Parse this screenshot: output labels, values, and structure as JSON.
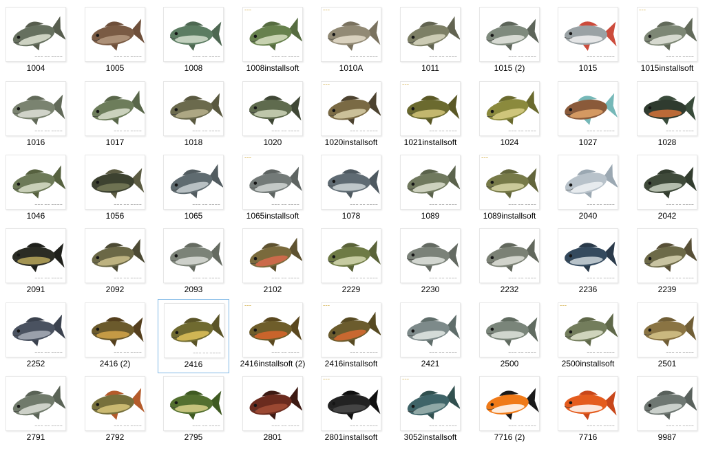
{
  "colors": {
    "selection_border": "#7fb8e6",
    "label_text": "#000000",
    "watermark_text": "#7a7a7a",
    "thumb_border": "#e7e7e7"
  },
  "files": [
    {
      "name": "1004",
      "icon": "fish-thumbnail-icon",
      "colors": {
        "body": "#66705f",
        "belly": "#dfe3d4",
        "fin": "#575d4e"
      }
    },
    {
      "name": "1005",
      "icon": "fish-thumbnail-icon",
      "colors": {
        "body": "#7a5b44",
        "belly": "#b59a80",
        "fin": "#6e4f3a"
      }
    },
    {
      "name": "1008",
      "icon": "fish-thumbnail-icon",
      "colors": {
        "body": "#5c7c62",
        "belly": "#d4dfcf",
        "fin": "#4e6852"
      }
    },
    {
      "name": "1008installsoft",
      "icon": "fish-thumbnail-icon",
      "colors": {
        "body": "#67814d",
        "belly": "#d8e1c2",
        "fin": "#566c40"
      }
    },
    {
      "name": "1010A",
      "icon": "fish-thumbnail-icon",
      "colors": {
        "body": "#928a75",
        "belly": "#e5ddcb",
        "fin": "#7a725f"
      }
    },
    {
      "name": "1011",
      "icon": "fish-thumbnail-icon",
      "colors": {
        "body": "#7d7f65",
        "belly": "#d9d8c2",
        "fin": "#626451"
      }
    },
    {
      "name": "1015 (2)",
      "icon": "fish-thumbnail-icon",
      "colors": {
        "body": "#7f8a7d",
        "belly": "#e6e8e2",
        "fin": "#5d655a"
      }
    },
    {
      "name": "1015",
      "icon": "fish-thumbnail-icon",
      "colors": {
        "body": "#9aa2a5",
        "belly": "#f1f1f1",
        "fin": "#cc4b3b"
      }
    },
    {
      "name": "1015installsoft",
      "icon": "fish-thumbnail-icon",
      "colors": {
        "body": "#7d8775",
        "belly": "#e5e7df",
        "fin": "#626a5a"
      }
    },
    {
      "name": "1016",
      "icon": "fish-thumbnail-icon",
      "colors": {
        "body": "#7a8370",
        "belly": "#dfe2d8",
        "fin": "#626a59"
      }
    },
    {
      "name": "1017",
      "icon": "fish-thumbnail-icon",
      "colors": {
        "body": "#6d7d5b",
        "belly": "#dce1cf",
        "fin": "#59674a"
      }
    },
    {
      "name": "1018",
      "icon": "fish-thumbnail-icon",
      "colors": {
        "body": "#6b6a4d",
        "belly": "#b9b18e",
        "fin": "#5a5940"
      }
    },
    {
      "name": "1020",
      "icon": "fish-thumbnail-icon",
      "colors": {
        "body": "#5f6b4e",
        "belly": "#cfd6bb",
        "fin": "#3f4735"
      }
    },
    {
      "name": "1020installsoft",
      "icon": "fish-thumbnail-icon",
      "colors": {
        "body": "#7a6a44",
        "belly": "#d9cfa8",
        "fin": "#4d4330"
      }
    },
    {
      "name": "1021installsoft",
      "icon": "fish-thumbnail-icon",
      "colors": {
        "body": "#6b6a2f",
        "belly": "#d2c479",
        "fin": "#5a5826"
      }
    },
    {
      "name": "1024",
      "icon": "fish-thumbnail-icon",
      "colors": {
        "body": "#8b8a3d",
        "belly": "#d9cf86",
        "fin": "#6a6a2e"
      }
    },
    {
      "name": "1027",
      "icon": "fish-thumbnail-icon",
      "colors": {
        "body": "#8a5a3a",
        "belly": "#e0a46a",
        "fin": "#75b8b8"
      }
    },
    {
      "name": "1028",
      "icon": "fish-thumbnail-icon",
      "colors": {
        "body": "#2f3b2f",
        "belly": "#d4733a",
        "fin": "#394b3a"
      }
    },
    {
      "name": "1046",
      "icon": "fish-thumbnail-icon",
      "colors": {
        "body": "#6d7a58",
        "belly": "#d9dfc9",
        "fin": "#56613f"
      }
    },
    {
      "name": "1056",
      "icon": "fish-thumbnail-icon",
      "colors": {
        "body": "#3d4230",
        "belly": "#777a58",
        "fin": "#5b5b42"
      }
    },
    {
      "name": "1065",
      "icon": "fish-thumbnail-icon",
      "colors": {
        "body": "#5f6b70",
        "belly": "#c8cfd1",
        "fin": "#525c60"
      }
    },
    {
      "name": "1065installsoft",
      "icon": "fish-thumbnail-icon",
      "colors": {
        "body": "#737a78",
        "belly": "#d1d6d3",
        "fin": "#5e6462"
      }
    },
    {
      "name": "1078",
      "icon": "fish-thumbnail-icon",
      "colors": {
        "body": "#5f6b73",
        "belly": "#cfd6d8",
        "fin": "#4e5960"
      }
    },
    {
      "name": "1089",
      "icon": "fish-thumbnail-icon",
      "colors": {
        "body": "#70795e",
        "belly": "#dde1cf",
        "fin": "#5b634c"
      }
    },
    {
      "name": "1089installsoft",
      "icon": "fish-thumbnail-icon",
      "colors": {
        "body": "#777a48",
        "belly": "#d8d7a8",
        "fin": "#62653b"
      }
    },
    {
      "name": "2040",
      "icon": "fish-thumbnail-icon",
      "colors": {
        "body": "#b8c2ca",
        "belly": "#eef2f5",
        "fin": "#9ba8b2"
      }
    },
    {
      "name": "2042",
      "icon": "fish-thumbnail-icon",
      "colors": {
        "body": "#3f4a3a",
        "belly": "#c9d1c2",
        "fin": "#323c2e"
      }
    },
    {
      "name": "2091",
      "icon": "fish-thumbnail-icon",
      "colors": {
        "body": "#2b2c24",
        "belly": "#b9a75a",
        "fin": "#1f201b"
      }
    },
    {
      "name": "2092",
      "icon": "fish-thumbnail-icon",
      "colors": {
        "body": "#6b6846",
        "belly": "#cbbf8b",
        "fin": "#4c4a34"
      }
    },
    {
      "name": "2093",
      "icon": "fish-thumbnail-icon",
      "colors": {
        "body": "#7c8378",
        "belly": "#dcded8",
        "fin": "#656b61"
      }
    },
    {
      "name": "2102",
      "icon": "fish-thumbnail-icon",
      "colors": {
        "body": "#7a6a3c",
        "belly": "#d96a4c",
        "fin": "#5e5230"
      }
    },
    {
      "name": "2229",
      "icon": "fish-thumbnail-icon",
      "colors": {
        "body": "#6e7a45",
        "belly": "#d6d9b1",
        "fin": "#5a6339"
      }
    },
    {
      "name": "2230",
      "icon": "fish-thumbnail-icon",
      "colors": {
        "body": "#7b8279",
        "belly": "#e2e5df",
        "fin": "#646a62"
      }
    },
    {
      "name": "2232",
      "icon": "fish-thumbnail-icon",
      "colors": {
        "body": "#7b8175",
        "belly": "#e0e2da",
        "fin": "#62685d"
      }
    },
    {
      "name": "2236",
      "icon": "fish-thumbnail-icon",
      "colors": {
        "body": "#344a5e",
        "belly": "#cfd7dc",
        "fin": "#2a3a4a"
      }
    },
    {
      "name": "2239",
      "icon": "fish-thumbnail-icon",
      "colors": {
        "body": "#6d6a48",
        "belly": "#d8d2b2",
        "fin": "#574f36"
      }
    },
    {
      "name": "2252",
      "icon": "fish-thumbnail-icon",
      "colors": {
        "body": "#4a5260",
        "belly": "#a8aeb8",
        "fin": "#3b424e"
      }
    },
    {
      "name": "2416 (2)",
      "icon": "fish-thumbnail-icon",
      "colors": {
        "body": "#6b5a2c",
        "belly": "#d4a64a",
        "fin": "#543f1d"
      }
    },
    {
      "name": "2416",
      "icon": "fish-thumbnail-icon",
      "colors": {
        "body": "#6f6a30",
        "belly": "#e0c25a",
        "fin": "#5a5427"
      }
    },
    {
      "name": "2416installsoft (2)",
      "icon": "fish-thumbnail-icon",
      "colors": {
        "body": "#6e5d2a",
        "belly": "#d9652c",
        "fin": "#5a481f"
      }
    },
    {
      "name": "2416installsoft",
      "icon": "fish-thumbnail-icon",
      "colors": {
        "body": "#6b5c2d",
        "belly": "#d86a31",
        "fin": "#574a22"
      }
    },
    {
      "name": "2421",
      "icon": "fish-thumbnail-icon",
      "colors": {
        "body": "#7d8a8a",
        "belly": "#e3e9e5",
        "fin": "#5f6d6a"
      }
    },
    {
      "name": "2500",
      "icon": "fish-thumbnail-icon",
      "colors": {
        "body": "#7a857a",
        "belly": "#dfe4dd",
        "fin": "#606b60"
      }
    },
    {
      "name": "2500installsoft",
      "icon": "fish-thumbnail-icon",
      "colors": {
        "body": "#737d5c",
        "belly": "#dfe3cc",
        "fin": "#5f6849"
      }
    },
    {
      "name": "2501",
      "icon": "fish-thumbnail-icon",
      "colors": {
        "body": "#8a7443",
        "belly": "#d5c48a",
        "fin": "#705e36"
      }
    },
    {
      "name": "2791",
      "icon": "fish-thumbnail-icon",
      "colors": {
        "body": "#707a6b",
        "belly": "#dde1d8",
        "fin": "#5a6356"
      }
    },
    {
      "name": "2792",
      "icon": "fish-thumbnail-icon",
      "colors": {
        "body": "#77703c",
        "belly": "#d8c67a",
        "fin": "#b45b2b"
      }
    },
    {
      "name": "2795",
      "icon": "fish-thumbnail-icon",
      "colors": {
        "body": "#536f2f",
        "belly": "#d9d28a",
        "fin": "#3f5a22"
      }
    },
    {
      "name": "2801",
      "icon": "fish-thumbnail-icon",
      "colors": {
        "body": "#6b2b1e",
        "belly": "#a34d36",
        "fin": "#3d1a13"
      }
    },
    {
      "name": "2801installsoft",
      "icon": "fish-thumbnail-icon",
      "colors": {
        "body": "#222222",
        "belly": "#4a4a4a",
        "fin": "#101010"
      }
    },
    {
      "name": "3052installsoft",
      "icon": "fish-thumbnail-icon",
      "colors": {
        "body": "#3f6468",
        "belly": "#9fb4b2",
        "fin": "#31504f"
      }
    },
    {
      "name": "7716 (2)",
      "icon": "fish-thumbnail-icon",
      "colors": {
        "body": "#f07a18",
        "belly": "#ffffff",
        "fin": "#1a1a1a"
      }
    },
    {
      "name": "7716",
      "icon": "fish-thumbnail-icon",
      "colors": {
        "body": "#e45c1e",
        "belly": "#ffffff",
        "fin": "#c8471a"
      }
    },
    {
      "name": "9987",
      "icon": "fish-thumbnail-icon",
      "colors": {
        "body": "#6e7772",
        "belly": "#dadfdb",
        "fin": "#59615c"
      }
    }
  ],
  "selected_index": 38
}
